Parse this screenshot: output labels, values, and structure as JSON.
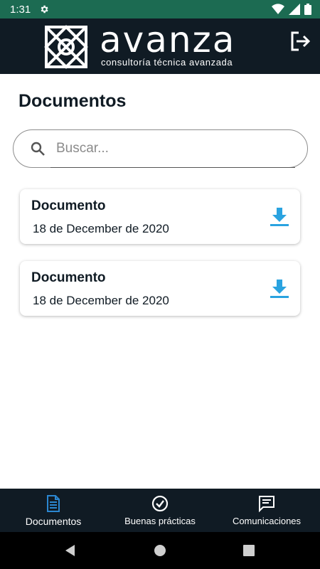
{
  "status_bar": {
    "time": "1:31"
  },
  "header": {
    "brand": "avanza",
    "tagline": "consultoría técnica avanzada"
  },
  "page": {
    "title": "Documentos"
  },
  "search": {
    "placeholder": "Buscar...",
    "value": ""
  },
  "documents": [
    {
      "title": "Documento",
      "date": "18 de December de 2020"
    },
    {
      "title": "Documento",
      "date": "18 de December de 2020"
    }
  ],
  "bottom_nav": {
    "items": [
      {
        "label": "Documentos",
        "icon": "document-icon",
        "active": true
      },
      {
        "label": "Buenas prácticas",
        "icon": "check-circle-icon",
        "active": false
      },
      {
        "label": "Comunicaciones",
        "icon": "chat-icon",
        "active": false
      }
    ]
  },
  "colors": {
    "status_bar": "#1c6b52",
    "header": "#101b24",
    "accent": "#2aa3e0",
    "nav_active": "#2b87d1"
  }
}
